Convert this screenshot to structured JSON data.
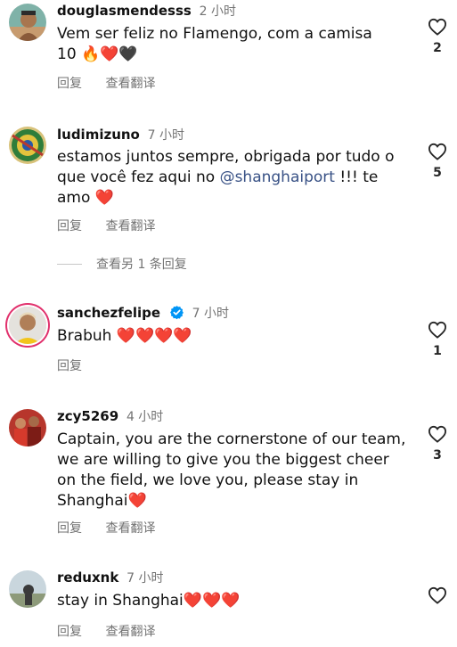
{
  "comments": [
    {
      "username": "douglasmendesss",
      "time": "2 小时",
      "text": "Vem ser feliz no Flamengo, com a camisa 10",
      "emoji": [
        "🔥",
        "❤️",
        "🖤"
      ],
      "reply_label": "回复",
      "translate_label": "查看翻译",
      "likes": "2"
    },
    {
      "username": "ludimizuno",
      "time": "7 小时",
      "text_before": "estamos juntos sempre, obrigada por tudo o que você fez aqui no",
      "mention": "@shanghaiport",
      "text_after": "!!! te amo",
      "emoji": [
        "❤️"
      ],
      "reply_label": "回复",
      "translate_label": "查看翻译",
      "likes": "5",
      "view_replies_label": "查看另 1 条回复"
    },
    {
      "username": "sanchezfelipe",
      "time": "7 小时",
      "verified": true,
      "text": "Brabuh",
      "emoji": [
        "❤️",
        "❤️",
        "❤️",
        "❤️"
      ],
      "reply_label": "回复",
      "likes": "1"
    },
    {
      "username": "zcy5269",
      "time": "4 小时",
      "text": "Captain, you are the cornerstone of our team, we are willing to give you the biggest cheer on the field, we love you, please stay in Shanghai",
      "emoji": [
        "❤️"
      ],
      "reply_label": "回复",
      "translate_label": "查看翻译",
      "likes": "3"
    },
    {
      "username": "reduxnk",
      "time": "7 小时",
      "text": "stay in Shanghai",
      "emoji": [
        "❤️",
        "❤️",
        "❤️"
      ],
      "reply_label": "回复",
      "translate_label": "查看翻译",
      "likes": ""
    }
  ],
  "colors": {
    "muted": "#737373",
    "mention": "#385185",
    "verified": "#0095f6",
    "heart": "#e8122a"
  },
  "icons": {
    "like": "heart-outline-icon",
    "verified": "verified-badge-icon"
  }
}
